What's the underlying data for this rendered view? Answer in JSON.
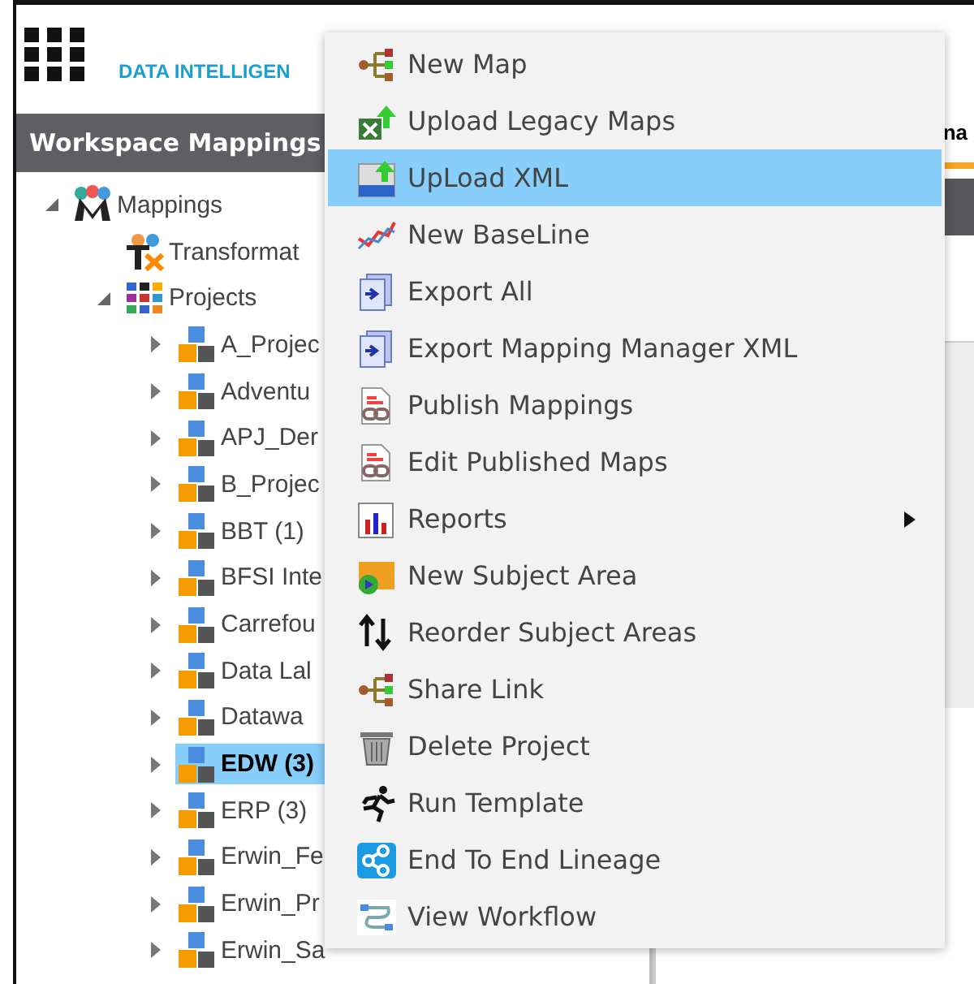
{
  "header": {
    "title": "DATA INTELLIGEN"
  },
  "panel": {
    "title": "Workspace Mappings"
  },
  "right_tab": {
    "label": "na"
  },
  "tree": [
    {
      "label": "Mappings",
      "expanded": true,
      "selected": false,
      "children": [
        {
          "label": "Transformat",
          "selected": false
        },
        {
          "label": "Projects",
          "expanded": true,
          "selected": false,
          "children": [
            {
              "label": "A_Projec",
              "expanded": false,
              "selected": false
            },
            {
              "label": "Adventu",
              "expanded": false,
              "selected": false
            },
            {
              "label": "APJ_Der",
              "expanded": false,
              "selected": false
            },
            {
              "label": "B_Projec",
              "expanded": false,
              "selected": false
            },
            {
              "label": "BBT (1)",
              "expanded": false,
              "selected": false
            },
            {
              "label": "BFSI Inte",
              "expanded": false,
              "selected": false
            },
            {
              "label": "Carrefou",
              "expanded": false,
              "selected": false
            },
            {
              "label": "Data Lal",
              "expanded": false,
              "selected": false
            },
            {
              "label": "Datawa",
              "expanded": false,
              "selected": false
            },
            {
              "label": "EDW (3)",
              "expanded": false,
              "selected": true
            },
            {
              "label": "ERP (3)",
              "expanded": false,
              "selected": false
            },
            {
              "label": "Erwin_Fe",
              "expanded": false,
              "selected": false
            },
            {
              "label": "Erwin_Pr",
              "expanded": false,
              "selected": false
            },
            {
              "label": "Erwin_Sa",
              "expanded": false,
              "selected": false
            }
          ]
        }
      ]
    }
  ],
  "context_menu": [
    {
      "label": "New Map",
      "selected": false
    },
    {
      "label": "Upload Legacy Maps",
      "selected": false
    },
    {
      "label": "UpLoad XML",
      "selected": true
    },
    {
      "label": "New BaseLine",
      "selected": false
    },
    {
      "label": "Export All",
      "selected": false
    },
    {
      "label": "Export Mapping Manager XML",
      "selected": false
    },
    {
      "label": "Publish Mappings",
      "selected": false
    },
    {
      "label": "Edit Published Maps",
      "selected": false
    },
    {
      "label": "Reports",
      "selected": false,
      "submenu": true
    },
    {
      "label": "New Subject Area",
      "selected": false
    },
    {
      "label": "Reorder Subject Areas",
      "selected": false
    },
    {
      "label": "Share Link",
      "selected": false
    },
    {
      "label": "Delete Project",
      "selected": false
    },
    {
      "label": "Run Template",
      "selected": false
    },
    {
      "label": "End To End Lineage",
      "selected": false
    },
    {
      "label": "View Workflow",
      "selected": false
    }
  ]
}
